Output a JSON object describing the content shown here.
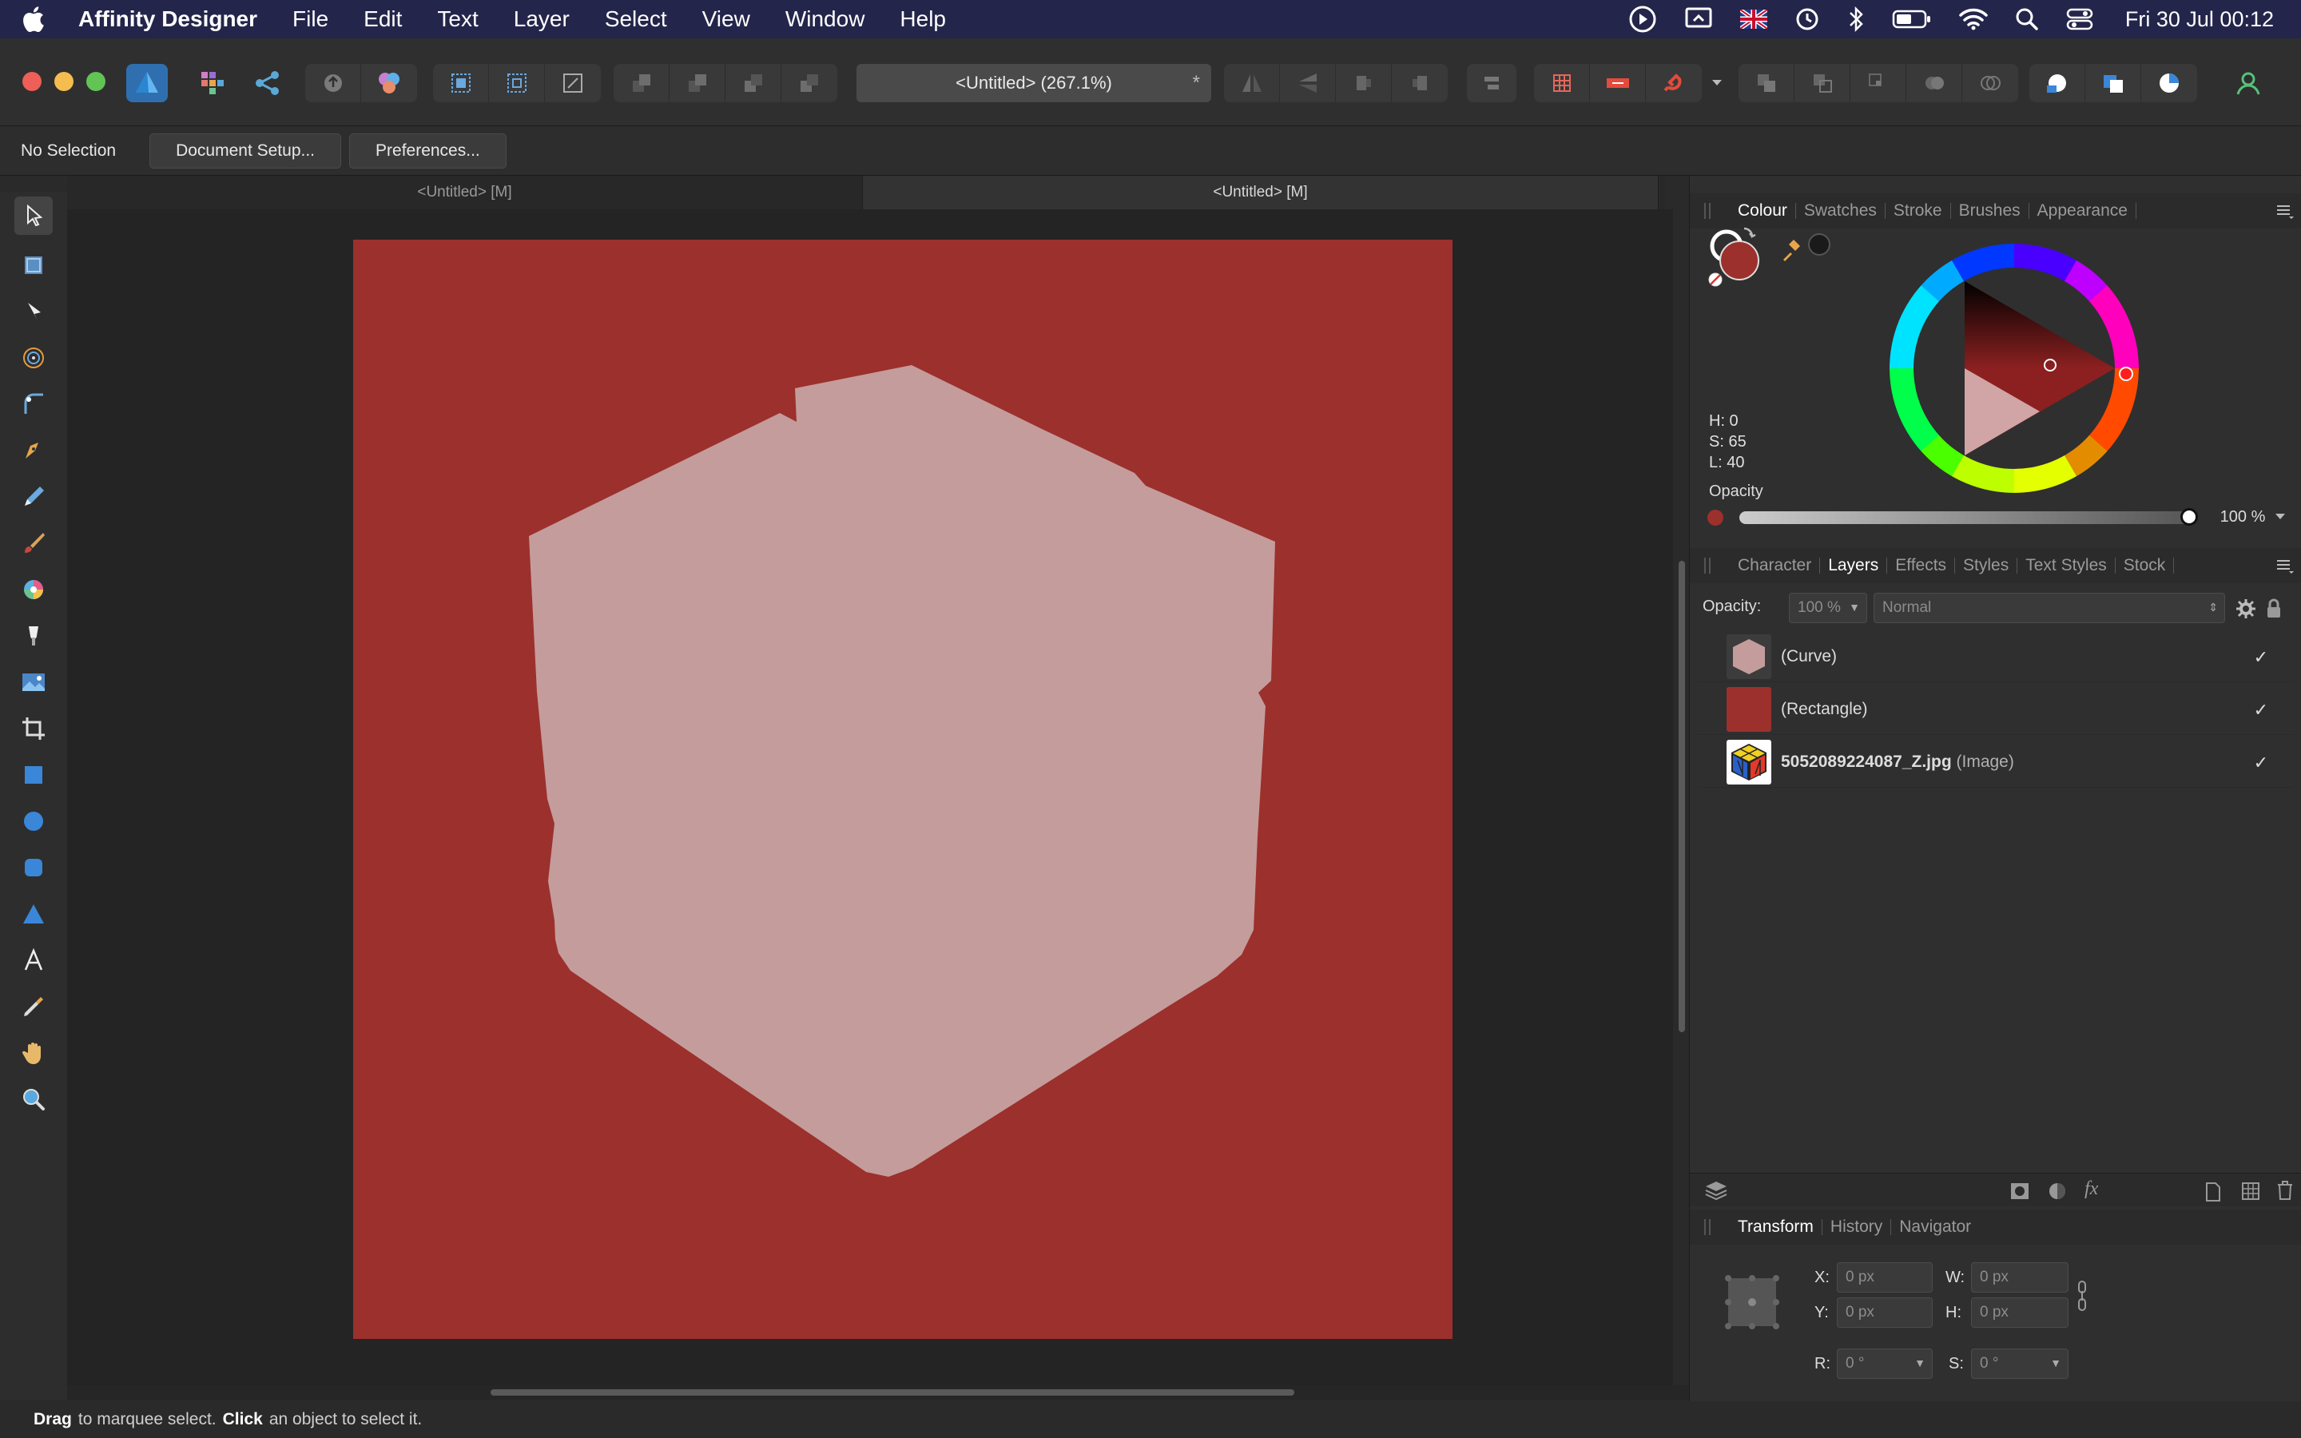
{
  "menubar": {
    "app_name": "Affinity Designer",
    "menus": [
      "File",
      "Edit",
      "Text",
      "Layer",
      "Select",
      "View",
      "Window",
      "Help"
    ],
    "clock": "Fri 30 Jul  00:12"
  },
  "toolbar": {
    "document_title": "<Untitled> (267.1%)",
    "modified_marker": "*"
  },
  "context_bar": {
    "selection_status": "No Selection",
    "document_setup_label": "Document Setup...",
    "preferences_label": "Preferences..."
  },
  "document_tabs": [
    "<Untitled> [M]",
    "<Untitled> [M]"
  ],
  "colour_panel": {
    "tabs": [
      "Colour",
      "Swatches",
      "Stroke",
      "Brushes",
      "Appearance"
    ],
    "active_tab": "Colour",
    "fill_color": "#9c302c",
    "h": "H: 0",
    "s": "S: 65",
    "l": "L: 40",
    "opacity_label": "Opacity",
    "opacity_value": "100 %"
  },
  "layers_panel": {
    "tabs": [
      "Character",
      "Layers",
      "Effects",
      "Styles",
      "Text Styles",
      "Stock"
    ],
    "active_tab": "Layers",
    "opacity_label": "Opacity:",
    "opacity_value": "100 %",
    "blend_mode": "Normal",
    "layers": [
      {
        "name": "(Curve)",
        "kind": "",
        "color": "#c49c9c"
      },
      {
        "name": "(Rectangle)",
        "kind": "",
        "color": "#9c302c"
      },
      {
        "name": "5052089224087_Z.jpg",
        "kind": " (Image)",
        "color": "#2a3a6a"
      }
    ]
  },
  "transform_panel": {
    "tabs": [
      "Transform",
      "History",
      "Navigator"
    ],
    "active_tab": "Transform",
    "x_label": "X:",
    "x_value": "0 px",
    "y_label": "Y:",
    "y_value": "0 px",
    "w_label": "W:",
    "w_value": "0 px",
    "h_label": "H:",
    "h_value": "0 px",
    "r_label": "R:",
    "r_value": "0 °",
    "s_label": "S:",
    "s_value": "0 °"
  },
  "status_bar": {
    "drag": "Drag",
    "drag_text": "to marquee select.",
    "click": "Click",
    "click_text": "an object to select it."
  },
  "canvas": {
    "artboard_color": "#9c302c",
    "shape_color": "#c49c9c"
  }
}
